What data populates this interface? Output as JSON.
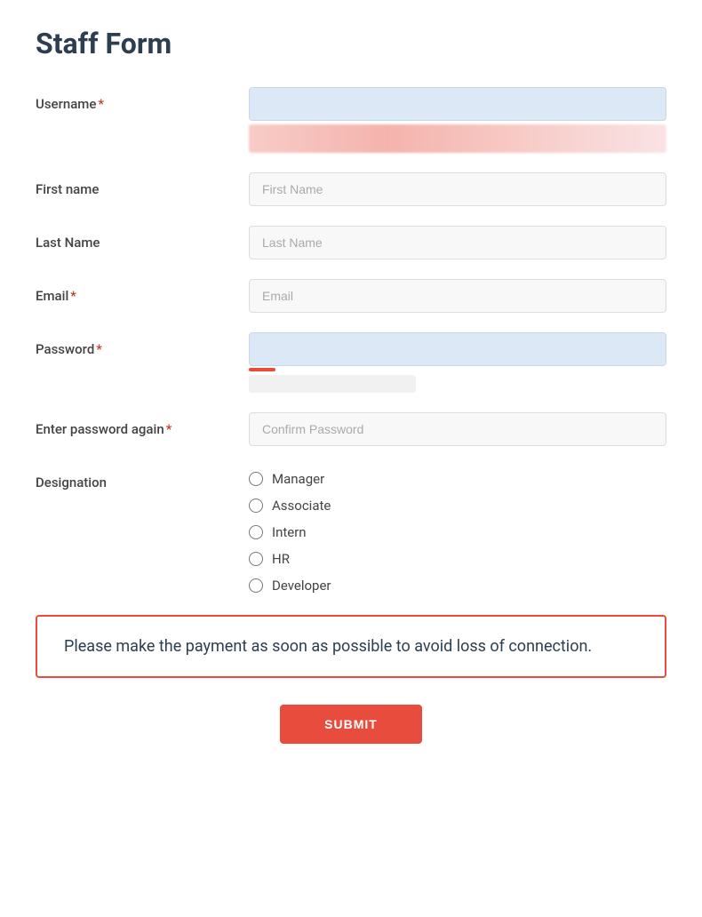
{
  "page": {
    "title": "Staff Form"
  },
  "form": {
    "fields": {
      "username": {
        "label": "Username",
        "required": true,
        "placeholder": ""
      },
      "first_name": {
        "label": "First name",
        "required": false,
        "placeholder": "First Name"
      },
      "last_name": {
        "label": "Last Name",
        "required": false,
        "placeholder": "Last Name"
      },
      "email": {
        "label": "Email",
        "required": true,
        "placeholder": "Email"
      },
      "password": {
        "label": "Password",
        "required": true,
        "placeholder": ""
      },
      "confirm_password": {
        "label": "Enter password again",
        "required": true,
        "placeholder": "Confirm Password"
      },
      "designation": {
        "label": "Designation",
        "required": false,
        "options": [
          "Manager",
          "Associate",
          "Intern",
          "HR",
          "Developer"
        ]
      }
    },
    "alert": {
      "text": "Please make the payment as soon as possible to avoid loss of connection."
    },
    "submit_label": "SUBMIT"
  }
}
